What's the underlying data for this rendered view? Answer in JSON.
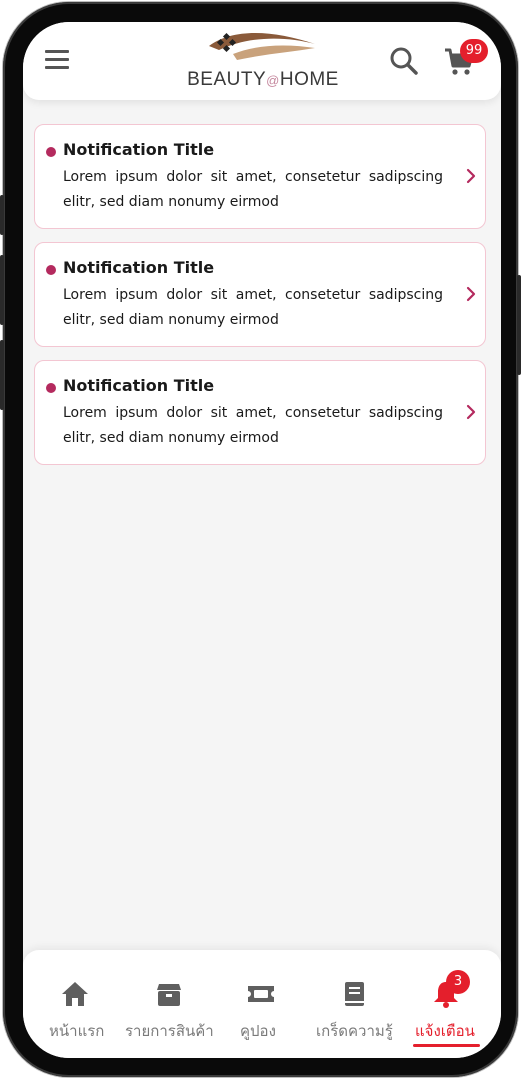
{
  "header": {
    "brand_left": "BEAUTY",
    "brand_at": "@",
    "brand_right": "HOME",
    "cart_count": "99"
  },
  "notifications": [
    {
      "title": "Notification Title",
      "body": "Lorem ipsum dolor sit amet, consetetur sadipscing elitr, sed diam nonumy eirmod"
    },
    {
      "title": "Notification Title",
      "body": "Lorem ipsum dolor sit amet, consetetur sadipscing elitr, sed diam nonumy eirmod"
    },
    {
      "title": "Notification Title",
      "body": "Lorem ipsum dolor sit amet, consetetur sadipscing elitr, sed diam nonumy eirmod"
    }
  ],
  "tabbar": {
    "items": [
      {
        "label": "หน้าแรก",
        "icon": "home-icon"
      },
      {
        "label": "รายการสินค้า",
        "icon": "box-icon"
      },
      {
        "label": "คูปอง",
        "icon": "ticket-icon"
      },
      {
        "label": "เกร็ดความรู้",
        "icon": "book-icon"
      },
      {
        "label": "แจ้งเตือน",
        "icon": "bell-icon"
      }
    ],
    "active_index": 4,
    "bell_badge": "3"
  },
  "colors": {
    "accent": "#e41f2c",
    "dot": "#b42a5e",
    "card_border": "#f3c6d2",
    "icon_gray": "#5f5f5f"
  }
}
